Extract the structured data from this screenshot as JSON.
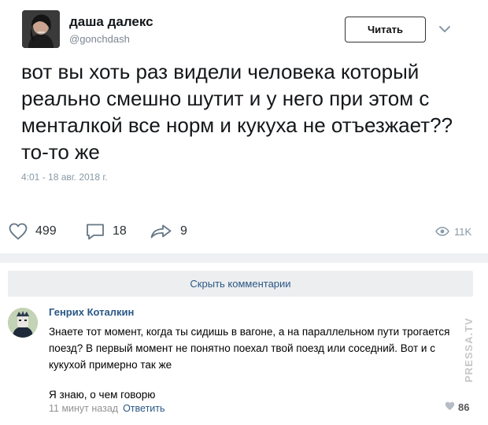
{
  "tweet": {
    "author": {
      "display_name": "даша далекс",
      "handle": "@gonchdash"
    },
    "follow_label": "Читать",
    "text": "вот вы хоть раз видели человека который реально смешно шутит и у него при этом с менталкой все норм и кукуха не отъезжает?? то-то же",
    "timestamp": "4:01 - 18 авг. 2018 г.",
    "stats": {
      "likes": "499",
      "replies": "18",
      "shares": "9",
      "views": "11K"
    }
  },
  "comments_section": {
    "hide_label": "Скрыть комментарии",
    "comment": {
      "author": "Генрих Коталкин",
      "text_line1": "Знаете тот момент, когда ты сидишь в вагоне, а на параллельном пути трогается поезд? В первый момент не понятно поехал твой поезд или соседний. Вот и с кукухой примерно так же",
      "text_line2": "Я знаю, о чем говорю",
      "time": "11 минут назад",
      "reply_label": "Ответить",
      "likes": "86"
    }
  },
  "watermark": "PRESSA.TV",
  "colors": {
    "link": "#2a5885",
    "muted": "#8899a6",
    "panel": "#edeef0"
  },
  "icons": [
    "heart-icon",
    "comment-icon",
    "share-icon",
    "eye-icon",
    "chevron-down-icon"
  ]
}
